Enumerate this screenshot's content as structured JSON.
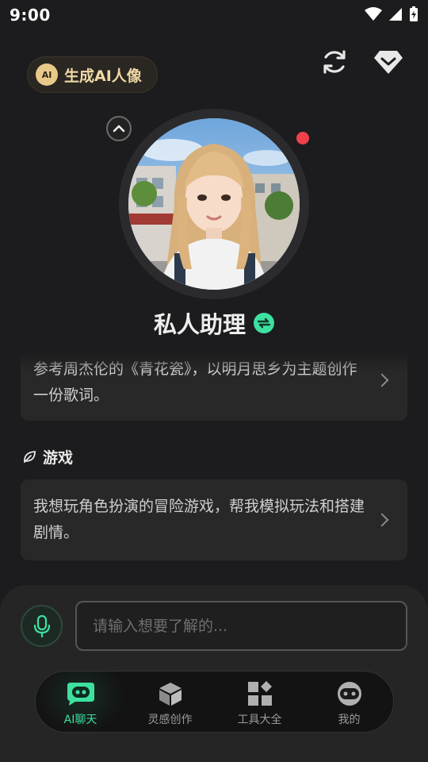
{
  "status_bar": {
    "time": "9:00",
    "icons": [
      "wifi-icon",
      "signal-icon",
      "battery-charging-icon"
    ]
  },
  "header": {
    "generate_button_badge": "AI",
    "generate_button_label": "生成AI人像",
    "refresh_icon": "refresh-icon",
    "vip_icon": "diamond-icon"
  },
  "assistant": {
    "name": "私人助理",
    "online": true
  },
  "prompts": [
    {
      "section": "",
      "text": "参考周杰伦的《青花瓷》，以明月思乡为主题创作一份歌词。"
    },
    {
      "section": "游戏",
      "text": "我想玩角色扮演的冒险游戏，帮我模拟玩法和搭建剧情。"
    }
  ],
  "input": {
    "placeholder": "请输入想要了解的..."
  },
  "tabs": [
    {
      "label": "AI聊天",
      "icon": "chat-bot-icon",
      "active": true
    },
    {
      "label": "灵感创作",
      "icon": "cube-icon",
      "active": false
    },
    {
      "label": "工具大全",
      "icon": "tools-grid-icon",
      "active": false
    },
    {
      "label": "我的",
      "icon": "profile-icon",
      "active": false
    }
  ],
  "colors": {
    "accent": "#3ee0a0",
    "gold": "#f0d9a6",
    "background": "#1c1c1e",
    "online_dot": "#f0414b"
  }
}
